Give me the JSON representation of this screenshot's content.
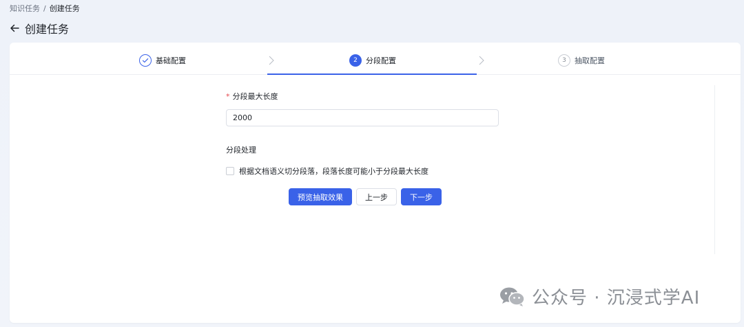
{
  "breadcrumb": {
    "parent": "知识任务",
    "separator": "/",
    "current": "创建任务"
  },
  "header": {
    "title": "创建任务",
    "back_icon": "arrow-left-icon"
  },
  "steps": [
    {
      "label": "基础配置",
      "state": "done",
      "marker": ""
    },
    {
      "label": "分段配置",
      "state": "active",
      "marker": "2"
    },
    {
      "label": "抽取配置",
      "state": "wait",
      "marker": "3"
    }
  ],
  "form": {
    "required_mark": "*",
    "max_length_label": "分段最大长度",
    "max_length_value": "2000",
    "section_title": "分段处理",
    "checkbox_label": "根据文档语义切分段落，段落长度可能小于分段最大长度",
    "checkbox_checked": false
  },
  "buttons": {
    "preview": "预览抽取效果",
    "prev": "上一步",
    "next": "下一步"
  },
  "watermark": {
    "text": "公众号 · 沉浸式学AI",
    "icon": "wechat-icon"
  },
  "colors": {
    "primary": "#3a62e8",
    "required": "#e5484d",
    "background": "#eef2f9"
  }
}
